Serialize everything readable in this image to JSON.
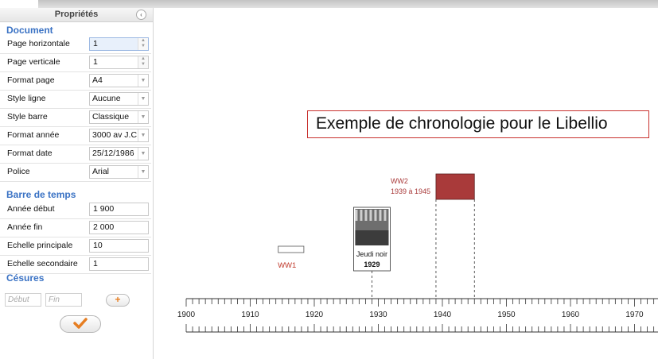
{
  "panel": {
    "title": "Propriétés",
    "sections": {
      "document": "Document",
      "timebar": "Barre de temps",
      "cesures": "Césures"
    },
    "document_rows": [
      {
        "label": "Page horizontale",
        "value": "1",
        "control": "spinner"
      },
      {
        "label": "Page verticale",
        "value": "1",
        "control": "spinner"
      },
      {
        "label": "Format page",
        "value": "A4",
        "control": "select"
      },
      {
        "label": "Style ligne",
        "value": "Aucune",
        "control": "select"
      },
      {
        "label": "Style barre",
        "value": "Classique",
        "control": "select"
      },
      {
        "label": "Format année",
        "value": "3000 av J.C.",
        "control": "select"
      },
      {
        "label": "Format date",
        "value": "25/12/1986",
        "control": "select"
      },
      {
        "label": "Police",
        "value": "Arial",
        "control": "select"
      }
    ],
    "timebar_rows": [
      {
        "label": "Année début",
        "value": "1 900"
      },
      {
        "label": "Année fin",
        "value": "2 000"
      },
      {
        "label": "Echelle principale",
        "value": "10"
      },
      {
        "label": "Echelle secondaire",
        "value": "1"
      }
    ],
    "cesure_start_placeholder": "Début",
    "cesure_end_placeholder": "Fin",
    "add_label": "+",
    "ok_icon": "checkmark-icon",
    "accent_color": "#3a72c4",
    "ok_color": "#e67e22"
  },
  "timeline": {
    "title": "Exemple de chronologie pour le Libellio",
    "start_year": 1900,
    "end_year": 1970,
    "major_step": 10,
    "minor_step": 1,
    "major_labels": [
      "1900",
      "1910",
      "1920",
      "1930",
      "1940",
      "1950",
      "1960",
      "1970"
    ],
    "events": {
      "ww1": {
        "label": "WW1",
        "start": 1914,
        "end": 1918,
        "color": "#c0392b"
      },
      "ww2": {
        "label": "WW2",
        "dates": "1939 à 1945",
        "start": 1939,
        "end": 1945,
        "color": "#a93a3a"
      },
      "jeudi_noir": {
        "label": "Jeudi noir",
        "year_label": "1929",
        "year": 1929
      }
    }
  }
}
